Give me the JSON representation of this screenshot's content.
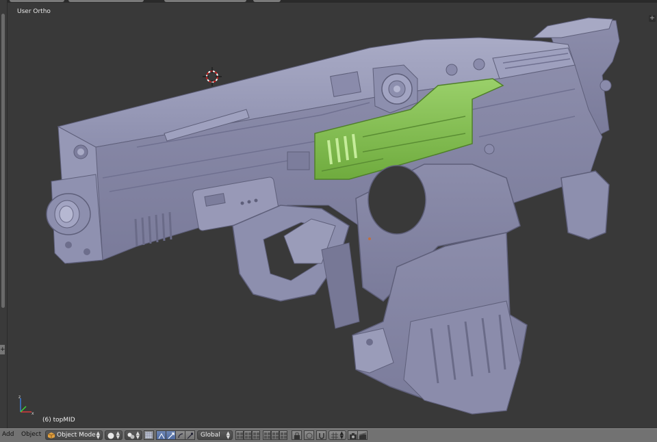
{
  "viewport": {
    "view_label": "User Ortho",
    "object_label": "(6) topMID"
  },
  "header": {
    "menu_add": "Add",
    "menu_object": "Object",
    "mode": "Object Mode",
    "orientation": "Global"
  },
  "icons": {
    "mode_icon": "cube-icon",
    "shading_icon": "sphere-icon",
    "pivot_icon": "pivot-icon",
    "manipulator_icons": [
      "translate-icon",
      "rotate-icon",
      "scale-icon"
    ],
    "layer_icon": "layer-grid-icon",
    "render_icons": [
      "camera-icon",
      "clapboard-icon"
    ]
  },
  "colors": {
    "model_body": "#8a8bab",
    "selected_part": "#7ab84a",
    "viewport_bg": "#393939",
    "header_bg": "#727272",
    "active_button": "#5673a8"
  }
}
